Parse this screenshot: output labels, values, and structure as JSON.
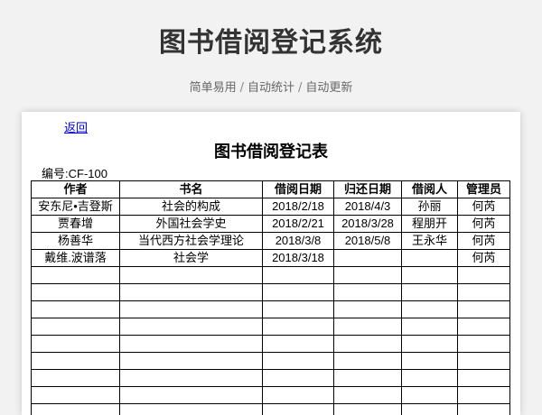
{
  "header": {
    "title": "图书借阅登记系统",
    "taglines": [
      "简单易用",
      "自动统计",
      "自动更新"
    ],
    "separator": "/"
  },
  "sheet": {
    "back_link": "返回",
    "title": "图书借阅登记表",
    "code_label": "编号:CF-100",
    "columns": [
      "作者",
      "书名",
      "借阅日期",
      "归还日期",
      "借阅人",
      "管理员"
    ],
    "rows": [
      [
        "安东尼•吉登斯",
        "社会的构成",
        "2018/2/18",
        "2018/4/3",
        "孙丽",
        "何芮"
      ],
      [
        "贾春增",
        "外国社会学史",
        "2018/2/21",
        "2018/3/28",
        "程朋开",
        "何芮"
      ],
      [
        "杨善华",
        "当代西方社会学理论",
        "2018/3/8",
        "2018/5/8",
        "王永华",
        "何芮"
      ],
      [
        "戴维.波谱落",
        "社会学",
        "2018/3/18",
        "",
        "",
        "何芮"
      ],
      [
        "",
        "",
        "",
        "",
        "",
        ""
      ],
      [
        "",
        "",
        "",
        "",
        "",
        ""
      ],
      [
        "",
        "",
        "",
        "",
        "",
        ""
      ],
      [
        "",
        "",
        "",
        "",
        "",
        ""
      ],
      [
        "",
        "",
        "",
        "",
        "",
        ""
      ],
      [
        "",
        "",
        "",
        "",
        "",
        ""
      ],
      [
        "",
        "",
        "",
        "",
        "",
        ""
      ],
      [
        "",
        "",
        "",
        "",
        "",
        ""
      ],
      [
        "",
        "",
        "",
        "",
        "",
        ""
      ]
    ]
  }
}
